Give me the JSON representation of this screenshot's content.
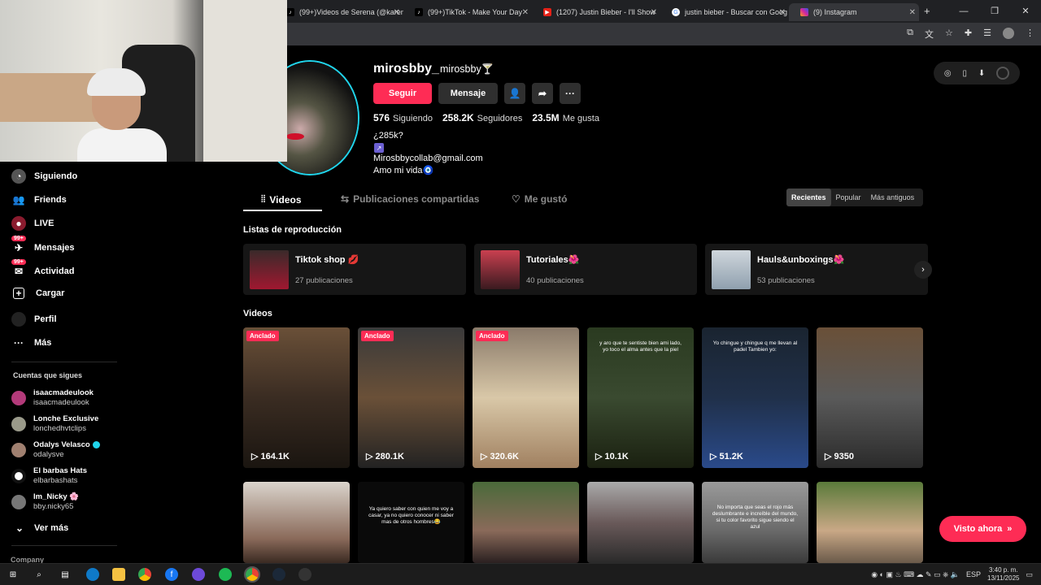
{
  "browser": {
    "tabs": [
      {
        "title": "(99+)Videos de Serena (@karen",
        "favicon": "tiktok-icon"
      },
      {
        "title": "(99+)TikTok - Make Your Day",
        "favicon": "tiktok-icon"
      },
      {
        "title": "(1207) Justin Bieber - I'll Show",
        "favicon": "youtube-icon"
      },
      {
        "title": "justin bieber - Buscar con Goog",
        "favicon": "google-icon"
      },
      {
        "title": "(9) Instagram",
        "favicon": "instagram-icon"
      }
    ],
    "new_tab": "+",
    "minimize": "—",
    "restore": "❐",
    "close": "✕"
  },
  "nav": {
    "items": [
      {
        "label": "Siguiendo",
        "icon": "following-icon"
      },
      {
        "label": "Friends",
        "icon": "friends-icon"
      },
      {
        "label": "LIVE",
        "icon": "live-icon"
      },
      {
        "label": "Mensajes",
        "icon": "messages-icon",
        "badge": "99+"
      },
      {
        "label": "Actividad",
        "icon": "activity-icon",
        "badge": "99+"
      },
      {
        "label": "Cargar",
        "icon": "upload-icon"
      },
      {
        "label": "Perfil",
        "icon": "profile-icon"
      },
      {
        "label": "Más",
        "icon": "more-icon"
      }
    ],
    "following_title": "Cuentas que sigues",
    "following": [
      {
        "name": "isaacmadeulook",
        "handle": "isaacmadeulook",
        "verified": false
      },
      {
        "name": "Lonche Exclusive",
        "handle": "lonchedhvtclips",
        "verified": false
      },
      {
        "name": "Odalys Velasco",
        "handle": "odalysve",
        "verified": true
      },
      {
        "name": "El barbas Hats",
        "handle": "elbarbashats",
        "verified": false
      },
      {
        "name": "Im_Nicky 🌸",
        "handle": "bby.nicky65",
        "verified": false
      }
    ],
    "see_more": "Ver más",
    "company": "Company"
  },
  "profile": {
    "username": "mirosbby_",
    "nickname": "mirosbby🍸",
    "follow_button": "Seguir",
    "message_button": "Mensaje",
    "stats": {
      "following_count": "576",
      "following_label": "Siguiendo",
      "followers_count": "258.2K",
      "followers_label": "Seguidores",
      "likes_count": "23.5M",
      "likes_label": "Me gusta"
    },
    "bio_line1": "¿285k?",
    "link_glyph": "↗",
    "bio_email": "Mirosbbycollab@gmail.com",
    "bio_line3": "Amo mi vida🧿"
  },
  "tabs": {
    "videos": "Videos",
    "reposts": "Publicaciones compartidas",
    "liked": "Me gustó"
  },
  "sort": {
    "recent": "Recientes",
    "popular": "Popular",
    "oldest": "Más antiguos"
  },
  "playlists_title": "Listas de reproducción",
  "playlists": [
    {
      "title": "Tiktok shop 💋",
      "count": "27 publicaciones"
    },
    {
      "title": "Tutoriales🌺",
      "count": "40 publicaciones"
    },
    {
      "title": "Hauls&unboxings🌺",
      "count": "53 publicaciones"
    }
  ],
  "videos_title": "Videos",
  "pinned_label": "Anclado",
  "videos_row1": [
    {
      "views": "164.1K",
      "pinned": true,
      "caption": ""
    },
    {
      "views": "280.1K",
      "pinned": true,
      "caption": ""
    },
    {
      "views": "320.6K",
      "pinned": true,
      "caption": ""
    },
    {
      "views": "10.1K",
      "pinned": false,
      "caption": "y aro que te sentiste bien ami lado, yo toco el alma antes que la piel"
    },
    {
      "views": "51.2K",
      "pinned": false,
      "caption": "Yo chingue y chingue q me llevan al padel Tambien yo:"
    },
    {
      "views": "9350",
      "pinned": false,
      "caption": ""
    }
  ],
  "videos_row2": [
    {
      "caption": ""
    },
    {
      "caption": "Ya quiero saber con quien me voy a casar, ya no quiero conocer ni saber mas de otros hombres😂"
    },
    {
      "caption": ""
    },
    {
      "caption": ""
    },
    {
      "caption": "No importa que seas el rojo más deslumbrante e increíble del mundo, si tu color favorito sigue siendo el azul"
    },
    {
      "caption": ""
    }
  ],
  "watch_now": "Visto ahora",
  "taskbar": {
    "language": "ESP",
    "time": "3:40 p. m.",
    "date": "13/11/2025"
  }
}
